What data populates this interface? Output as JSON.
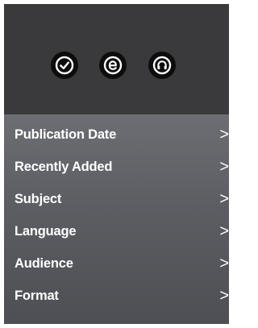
{
  "toolbar": {
    "icons": [
      {
        "name": "checkmark-icon"
      },
      {
        "name": "ebook-icon"
      },
      {
        "name": "headphones-icon"
      }
    ]
  },
  "menu": {
    "items": [
      {
        "label": "Publication Date",
        "chevron": ">"
      },
      {
        "label": "Recently Added",
        "chevron": ">"
      },
      {
        "label": "Subject",
        "chevron": ">"
      },
      {
        "label": "Language",
        "chevron": ">"
      },
      {
        "label": "Audience",
        "chevron": ">"
      },
      {
        "label": "Format",
        "chevron": ">"
      }
    ]
  },
  "colors": {
    "top_panel": "#3a3a3c",
    "icon_bg": "#0d0d0d",
    "menu_bg": "#5c5d62",
    "text": "#ffffff"
  }
}
